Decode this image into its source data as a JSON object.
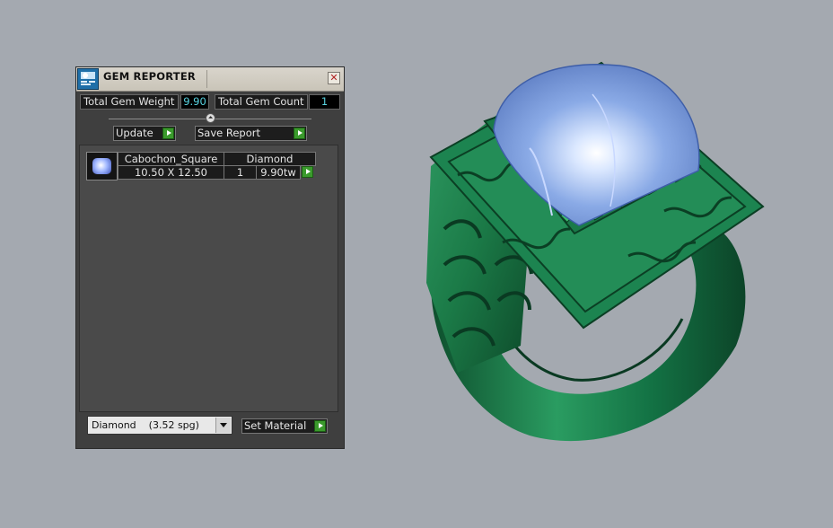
{
  "panel": {
    "title": "GEM REPORTER",
    "close_glyph": "✕",
    "app_icon": "gem-reporter-app-icon",
    "close_icon": "close-icon",
    "collapse_glyph": "⏶",
    "total_weight_label": "Total Gem Weight",
    "total_weight_value": "9.90",
    "total_count_label": "Total Gem Count",
    "total_count_value": "1",
    "update_label": "Update",
    "save_report_label": "Save Report",
    "gems": [
      {
        "shape": "Cabochon_Square",
        "material": "Diamond",
        "size": "10.50 X 12.50",
        "count": "1",
        "weight": "9.90tw"
      }
    ],
    "material_select": {
      "name": "Diamond",
      "spg": "(3.52 spg)"
    },
    "set_material_label": "Set Material"
  },
  "colors": {
    "panel_bg": "#3f3f3f",
    "value_text": "#58d3e0",
    "go_arrow": "#3a9a2c",
    "metal": "#1f7a4a",
    "gem": "#9ab4f0",
    "background": "#a4a9b0"
  }
}
